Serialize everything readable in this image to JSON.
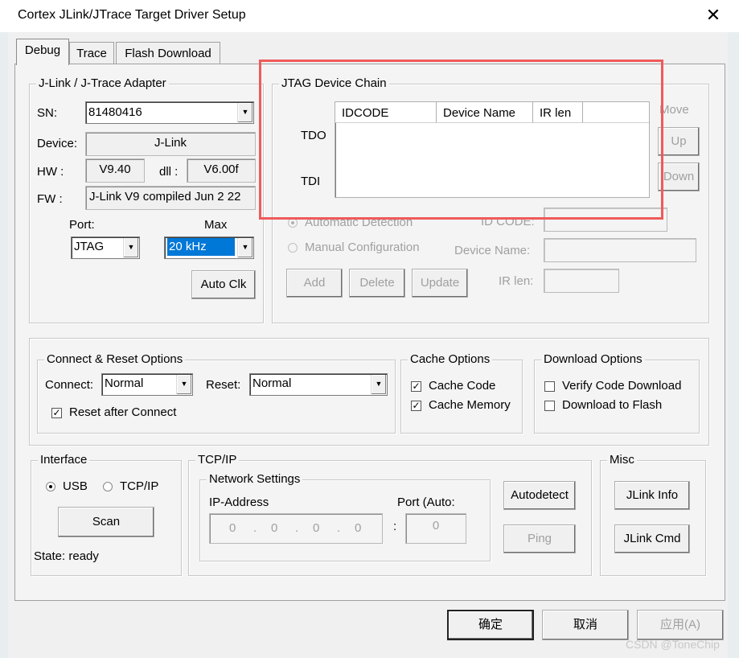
{
  "window": {
    "title": "Cortex JLink/JTrace Target Driver Setup",
    "close_label": "✕"
  },
  "tabs": [
    {
      "label": "Debug"
    },
    {
      "label": "Trace"
    },
    {
      "label": "Flash Download"
    }
  ],
  "adapter": {
    "group_label": "J-Link / J-Trace Adapter",
    "sn_label": "SN:",
    "sn_value": "81480416",
    "device_label": "Device:",
    "device_value": "J-Link",
    "hw_label": "HW :",
    "hw_value": "V9.40",
    "dll_label": "dll :",
    "dll_value": "V6.00f",
    "fw_label": "FW :",
    "fw_value": "J-Link V9 compiled Jun  2 22",
    "port_label": "Port:",
    "port_value": "JTAG",
    "max_label": "Max",
    "max_value": "20 kHz",
    "autoclk_label": "Auto Clk"
  },
  "jtag_chain": {
    "group_label": "JTAG Device Chain",
    "tdo_label": "TDO",
    "tdi_label": "TDI",
    "columns": [
      "IDCODE",
      "Device Name",
      "IR len"
    ],
    "move_label": "Move",
    "up_label": "Up",
    "down_label": "Down",
    "auto_detect_label": "Automatic Detection",
    "manual_config_label": "Manual Configuration",
    "idcode_label": "ID CODE:",
    "device_name_label": "Device Name:",
    "irlen_label": "IR len:",
    "add_label": "Add",
    "delete_label": "Delete",
    "update_label": "Update"
  },
  "connect_reset": {
    "group_label": "Connect & Reset Options",
    "connect_label": "Connect:",
    "connect_value": "Normal",
    "reset_label": "Reset:",
    "reset_value": "Normal",
    "reset_after_connect_label": "Reset after Connect",
    "reset_after_connect_checked": true
  },
  "cache": {
    "group_label": "Cache Options",
    "cache_code_label": "Cache Code",
    "cache_code_checked": true,
    "cache_memory_label": "Cache Memory",
    "cache_memory_checked": true
  },
  "download": {
    "group_label": "Download Options",
    "verify_label": "Verify Code Download",
    "verify_checked": false,
    "flash_label": "Download to Flash",
    "flash_checked": false
  },
  "interface": {
    "group_label": "Interface",
    "usb_label": "USB",
    "tcpip_label": "TCP/IP",
    "selected": "USB",
    "scan_label": "Scan",
    "state_text": "State: ready"
  },
  "tcpip": {
    "group_label": "TCP/IP",
    "network_label": "Network Settings",
    "ip_label": "IP-Address",
    "port_label": "Port (Auto:",
    "ip_octets": [
      "0",
      "0",
      "0",
      "0"
    ],
    "ip_dot": ".",
    "port_sep": ":",
    "port_value": "0",
    "autodetect_label": "Autodetect",
    "ping_label": "Ping"
  },
  "misc": {
    "group_label": "Misc",
    "jlink_info_label": "JLink Info",
    "jlink_cmd_label": "JLink Cmd"
  },
  "footer": {
    "ok_label": "确定",
    "cancel_label": "取消",
    "apply_label": "应用(A)"
  },
  "watermark": "CSDN @ToneChip",
  "highlight_color": "#f05a5a",
  "selection_color": "#0078d7"
}
